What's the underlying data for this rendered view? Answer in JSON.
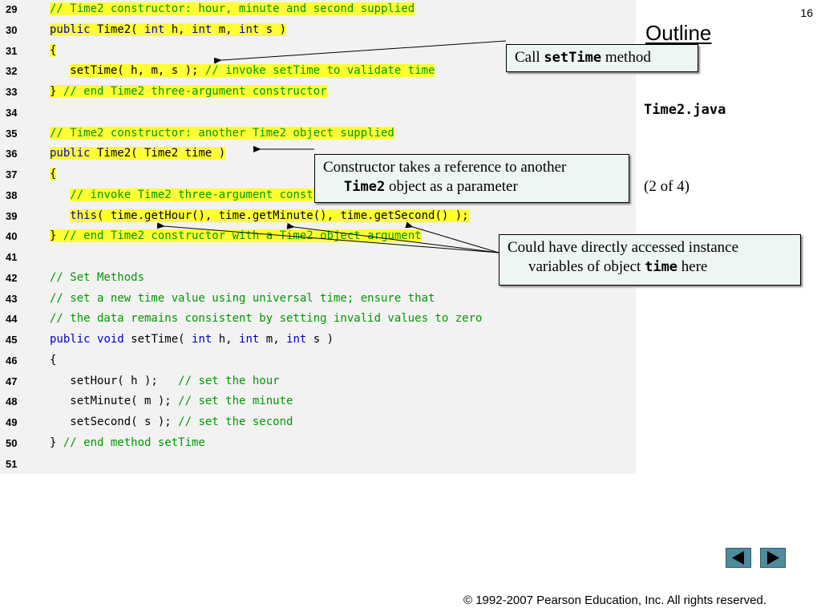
{
  "slide_number": "16",
  "outline_title": "Outline",
  "file_name": "Time2.java",
  "page_indicator": "(2 of 4)",
  "code_lines": [
    {
      "num": "29",
      "tokens": [
        {
          "t": "// Time2 constructor: hour, minute and second supplied",
          "c": "cm",
          "h": true
        }
      ]
    },
    {
      "num": "30",
      "tokens": [
        {
          "t": "public",
          "c": "kw",
          "h": true
        },
        {
          "t": " Time2( ",
          "c": "pl",
          "h": true
        },
        {
          "t": "int",
          "c": "kw",
          "h": true
        },
        {
          "t": " h, ",
          "c": "pl",
          "h": true
        },
        {
          "t": "int",
          "c": "kw",
          "h": true
        },
        {
          "t": " m, ",
          "c": "pl",
          "h": true
        },
        {
          "t": "int",
          "c": "kw",
          "h": true
        },
        {
          "t": " s )",
          "c": "pl",
          "h": true
        }
      ]
    },
    {
      "num": "31",
      "tokens": [
        {
          "t": "{",
          "c": "pl",
          "h": true
        }
      ]
    },
    {
      "num": "32",
      "tokens": [
        {
          "t": "   ",
          "c": "pl",
          "h": false
        },
        {
          "t": "setTime( h, m, s ); ",
          "c": "pl",
          "h": true
        },
        {
          "t": "// invoke setTime to validate time",
          "c": "cm",
          "h": true
        }
      ]
    },
    {
      "num": "33",
      "tokens": [
        {
          "t": "} ",
          "c": "pl",
          "h": true
        },
        {
          "t": "// end Time2 three-argument constructor",
          "c": "cm",
          "h": true
        }
      ]
    },
    {
      "num": "34",
      "tokens": []
    },
    {
      "num": "35",
      "tokens": [
        {
          "t": "// Time2 constructor: another Time2 object supplied",
          "c": "cm",
          "h": true
        }
      ]
    },
    {
      "num": "36",
      "tokens": [
        {
          "t": "public",
          "c": "kw",
          "h": true
        },
        {
          "t": " Time2( Time2 time )",
          "c": "pl",
          "h": true
        }
      ]
    },
    {
      "num": "37",
      "tokens": [
        {
          "t": "{",
          "c": "pl",
          "h": true
        }
      ]
    },
    {
      "num": "38",
      "tokens": [
        {
          "t": "   ",
          "c": "pl",
          "h": false
        },
        {
          "t": "// invoke Time2 three-argument constructor",
          "c": "cm",
          "h": true
        }
      ]
    },
    {
      "num": "39",
      "tokens": [
        {
          "t": "   ",
          "c": "pl",
          "h": false
        },
        {
          "t": "this",
          "c": "kw",
          "h": true
        },
        {
          "t": "( time.getHour(), time.getMinute(), time.getSecond() );",
          "c": "pl",
          "h": true
        }
      ]
    },
    {
      "num": "40",
      "tokens": [
        {
          "t": "} ",
          "c": "pl",
          "h": true
        },
        {
          "t": "// end Time2 constructor with a Time2 object argument",
          "c": "cm",
          "h": true
        }
      ]
    },
    {
      "num": "41",
      "tokens": []
    },
    {
      "num": "42",
      "tokens": [
        {
          "t": "// Set Methods",
          "c": "cm",
          "h": false
        }
      ]
    },
    {
      "num": "43",
      "tokens": [
        {
          "t": "// set a new time value using universal time; ensure that",
          "c": "cm",
          "h": false
        }
      ]
    },
    {
      "num": "44",
      "tokens": [
        {
          "t": "// the data remains consistent by setting invalid values to zero",
          "c": "cm",
          "h": false
        }
      ]
    },
    {
      "num": "45",
      "tokens": [
        {
          "t": "public",
          "c": "kw",
          "h": false
        },
        {
          "t": " ",
          "c": "pl",
          "h": false
        },
        {
          "t": "void",
          "c": "kw",
          "h": false
        },
        {
          "t": " setTime( ",
          "c": "pl",
          "h": false
        },
        {
          "t": "int",
          "c": "kw",
          "h": false
        },
        {
          "t": " h, ",
          "c": "pl",
          "h": false
        },
        {
          "t": "int",
          "c": "kw",
          "h": false
        },
        {
          "t": " m, ",
          "c": "pl",
          "h": false
        },
        {
          "t": "int",
          "c": "kw",
          "h": false
        },
        {
          "t": " s )",
          "c": "pl",
          "h": false
        }
      ]
    },
    {
      "num": "46",
      "tokens": [
        {
          "t": "{",
          "c": "pl",
          "h": false
        }
      ]
    },
    {
      "num": "47",
      "tokens": [
        {
          "t": "   setHour( h );   ",
          "c": "pl",
          "h": false
        },
        {
          "t": "// set the hour",
          "c": "cm",
          "h": false
        }
      ]
    },
    {
      "num": "48",
      "tokens": [
        {
          "t": "   setMinute( m ); ",
          "c": "pl",
          "h": false
        },
        {
          "t": "// set the minute",
          "c": "cm",
          "h": false
        }
      ]
    },
    {
      "num": "49",
      "tokens": [
        {
          "t": "   setSecond( s ); ",
          "c": "pl",
          "h": false
        },
        {
          "t": "// set the second",
          "c": "cm",
          "h": false
        }
      ]
    },
    {
      "num": "50",
      "tokens": [
        {
          "t": "} ",
          "c": "pl",
          "h": false
        },
        {
          "t": "// end method setTime",
          "c": "cm",
          "h": false
        }
      ]
    },
    {
      "num": "51",
      "tokens": []
    }
  ],
  "callouts": {
    "settime": {
      "prefix": "Call ",
      "code": "setTime",
      "suffix": " method"
    },
    "constructor": {
      "line1": "Constructor takes a reference to another",
      "code": "Time2",
      "suffix": " object as a parameter"
    },
    "instance": {
      "line1": "Could have directly accessed instance",
      "prefix": "variables of object ",
      "code": "time",
      "suffix": " here"
    }
  },
  "nav": {
    "prev_icon": "left-triangle-icon",
    "next_icon": "right-triangle-icon"
  },
  "copyright": "© 1992-2007 Pearson Education, Inc.  All rights reserved.",
  "colors": {
    "highlight": "#ffff33",
    "keyword": "#0000cc",
    "comment": "#009900",
    "callout_bg": "#eef5f5",
    "nav_button": "#4f8a9d"
  }
}
